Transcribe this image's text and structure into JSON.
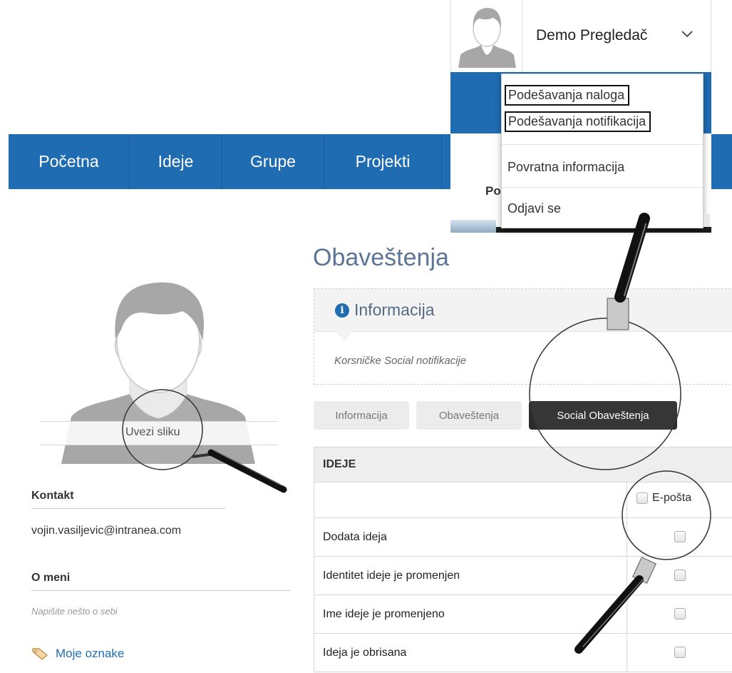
{
  "nav": {
    "items": [
      "Početna",
      "Ideje",
      "Grupe",
      "Projekti"
    ]
  },
  "profile": {
    "upload_label": "Uvezi sliku",
    "contact_heading": "Kontakt",
    "email": "vojin.vasiljevic@intranea.com",
    "about_heading": "O meni",
    "about_placeholder": "Napišite nešto o sebi",
    "tags_link": "Moje oznake"
  },
  "main": {
    "title": "Obaveštenja",
    "info_heading": "Informacija",
    "info_text": "Korsničke Social notifikacije",
    "tabs": [
      "Informacija",
      "Obaveštenja",
      "Social Obaveštenja"
    ],
    "active_tab": "Social Obaveštenja"
  },
  "table": {
    "section": "IDEJE",
    "email_column": "E-pošta",
    "rows": [
      "Dodata ideja",
      "Identitet ideje je promenjen",
      "Ime ideje je promenjeno",
      "Ideja je obrisana"
    ]
  },
  "user_menu": {
    "user_name": "Demo Pregledač",
    "items": [
      "Podešavanja naloga",
      "Podešavanja notifikacija",
      "Povratna informacija",
      "Odjavi se"
    ],
    "background_fragment": "Po"
  },
  "icons": {
    "chevron": "chevron-down-icon",
    "info": "info-icon",
    "tag": "tag-icon",
    "avatar": "user-avatar-icon",
    "magnifier": "magnifier-icon"
  },
  "colors": {
    "nav_blue": "#1f6cb3",
    "title_blue": "#5b7596",
    "active_tab": "#2a2a2a"
  }
}
